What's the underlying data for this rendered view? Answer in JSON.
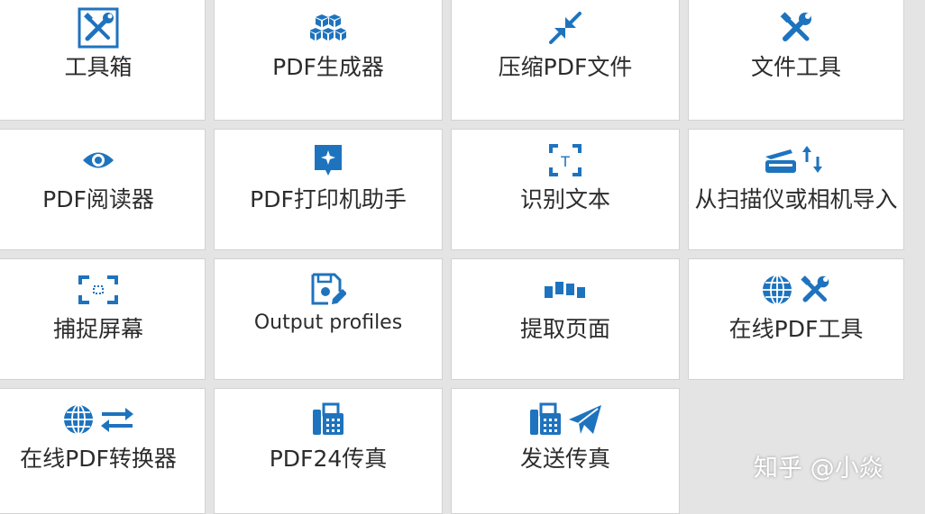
{
  "accent_color": "#1e73be",
  "tiles": [
    {
      "label": "工具箱",
      "icon": "toolbox-icon"
    },
    {
      "label": "PDF生成器",
      "icon": "cubes-icon"
    },
    {
      "label": "压缩PDF文件",
      "icon": "compress-arrows-icon"
    },
    {
      "label": "文件工具",
      "icon": "tools-icon"
    },
    {
      "label": "PDF阅读器",
      "icon": "eye-icon"
    },
    {
      "label": "PDF打印机助手",
      "icon": "assistant-icon"
    },
    {
      "label": "识别文本",
      "icon": "text-scan-icon"
    },
    {
      "label": "从扫描仪或相机导入",
      "icon": "scanner-import-icon"
    },
    {
      "label": "捕捉屏幕",
      "icon": "screen-capture-icon"
    },
    {
      "label": "Output profiles",
      "icon": "profile-edit-icon"
    },
    {
      "label": "提取页面",
      "icon": "extract-pages-icon"
    },
    {
      "label": "在线PDF工具",
      "icon": "globe-tools-icon"
    },
    {
      "label": "在线PDF转换器",
      "icon": "globe-convert-icon"
    },
    {
      "label": "PDF24传真",
      "icon": "fax-icon"
    },
    {
      "label": "发送传真",
      "icon": "fax-send-icon"
    }
  ],
  "watermark": "知乎 @小焱"
}
